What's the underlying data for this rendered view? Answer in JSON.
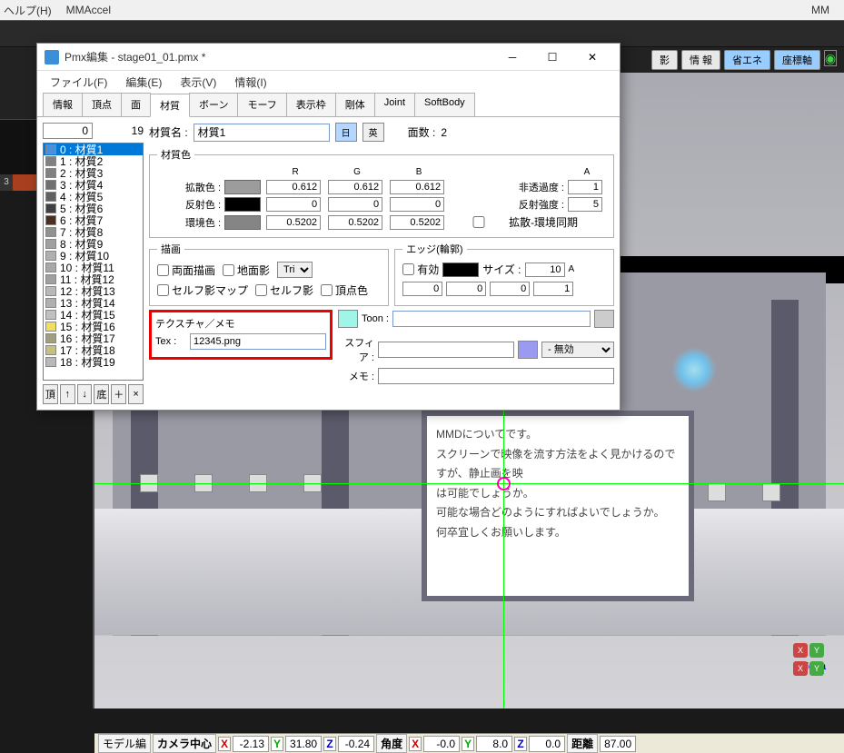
{
  "mmd": {
    "menu": {
      "help": "ヘルプ(H)",
      "mmaccel": "MMAccel",
      "mm_right": "MM"
    },
    "viewport_buttons": {
      "shadow": "影",
      "info": "情 報",
      "eco": "省エネ",
      "axis": "座標軸"
    },
    "screen_text": {
      "l1": "MMDについてです。",
      "l2": "スクリーンで映像を流す方法をよく見かけるのですが、静止画を映",
      "l3": "は可能でしょうか。",
      "l4": "可能な場合どのようにすればよいでしょうか。",
      "l5": "何卒宜しくお願いします。"
    },
    "axis_label": "loca",
    "status": {
      "model": "モデル編",
      "camera": "カメラ中心",
      "x1": "-2.13",
      "y1": "31.80",
      "z1": "-0.24",
      "angle": "角度",
      "x2": "-0.0",
      "y2": "8.0",
      "z2": "0.0",
      "dist_lbl": "距離",
      "dist_val": "87.00"
    }
  },
  "pmx": {
    "title": "Pmx編集 - stage01_01.pmx *",
    "menu": {
      "file": "ファイル(F)",
      "edit": "編集(E)",
      "view": "表示(V)",
      "info": "情報(I)"
    },
    "tabs": [
      "情報",
      "頂点",
      "面",
      "材質",
      "ボーン",
      "モーフ",
      "表示枠",
      "剛体",
      "Joint",
      "SoftBody"
    ],
    "active_tab": 3,
    "left": {
      "index": "0",
      "total": "19",
      "items": [
        {
          "label": "0 : 材質1",
          "color": "#4a90d9",
          "sel": true
        },
        {
          "label": "1 : 材質2",
          "color": "#808080"
        },
        {
          "label": "2 : 材質3",
          "color": "#808080"
        },
        {
          "label": "3 : 材質4",
          "color": "#707070"
        },
        {
          "label": "4 : 材質5",
          "color": "#606060"
        },
        {
          "label": "5 : 材質6",
          "color": "#404040"
        },
        {
          "label": "6 : 材質7",
          "color": "#4a3020"
        },
        {
          "label": "7 : 材質8",
          "color": "#909090"
        },
        {
          "label": "8 : 材質9",
          "color": "#a0a0a0"
        },
        {
          "label": "9 : 材質10",
          "color": "#b0b0b0"
        },
        {
          "label": "10 : 材質11",
          "color": "#a8a8a8"
        },
        {
          "label": "11 : 材質12",
          "color": "#a0a0a0"
        },
        {
          "label": "12 : 材質13",
          "color": "#b8b8b8"
        },
        {
          "label": "13 : 材質14",
          "color": "#b0b0b0"
        },
        {
          "label": "14 : 材質15",
          "color": "#c0c0c0"
        },
        {
          "label": "15 : 材質16",
          "color": "#f0e060"
        },
        {
          "label": "16 : 材質17",
          "color": "#a0a080"
        },
        {
          "label": "17 : 材質18",
          "color": "#c8c080"
        },
        {
          "label": "18 : 材質19",
          "color": "#b8b8b8"
        }
      ],
      "btns": {
        "top": "頂",
        "up": "↑",
        "down": "↓",
        "bottom": "底",
        "add": "＋",
        "del": "×"
      }
    },
    "right": {
      "name_label": "材質名 :",
      "name_value": "材質1",
      "jp_btn": "日",
      "en_btn": "英",
      "face_label": "面数 :",
      "face_value": "2",
      "color_legend": "材質色",
      "hdr_r": "R",
      "hdr_g": "G",
      "hdr_b": "B",
      "hdr_a": "A",
      "diffuse_lbl": "拡散色 :",
      "diffuse_r": "0.612",
      "diffuse_g": "0.612",
      "diffuse_b": "0.612",
      "opacity_lbl": "非透過度 :",
      "opacity": "1",
      "spec_lbl": "反射色 :",
      "spec_r": "0",
      "spec_g": "0",
      "spec_b": "0",
      "spec_pow_lbl": "反射強度 :",
      "spec_pow": "5",
      "amb_lbl": "環境色 :",
      "amb_r": "0.5202",
      "amb_g": "0.5202",
      "amb_b": "0.5202",
      "sync_lbl": "拡散-環境同期",
      "draw_legend": "描画",
      "draw_both": "両面描画",
      "draw_ground": "地面影",
      "draw_tri": "Tri",
      "draw_selfmap": "セルフ影マップ",
      "draw_self": "セルフ影",
      "draw_vcolor": "頂点色",
      "edge_legend": "エッジ(輪郭)",
      "edge_enable": "有効",
      "edge_size_lbl": "サイズ :",
      "edge_size": "10",
      "hdr_a2": "A",
      "edge_r": "0",
      "edge_g": "0",
      "edge_b": "0",
      "edge_a": "1",
      "tex_legend": "テクスチャ／メモ",
      "tex_lbl": "Tex :",
      "tex_val": "12345.png",
      "toon_lbl": "Toon :",
      "toon_val": "",
      "sphere_lbl": "スフィア :",
      "sphere_val": "",
      "sphere_mode": "- 無効",
      "memo_lbl": "メモ :",
      "memo_val": ""
    }
  }
}
